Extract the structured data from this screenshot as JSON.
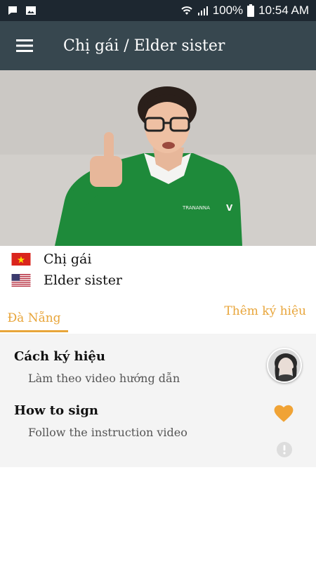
{
  "status_bar": {
    "battery": "100%",
    "time": "10:54 AM",
    "icons": [
      "chat-icon",
      "image-icon",
      "wifi-icon",
      "signal-icon",
      "battery-icon"
    ]
  },
  "app_bar": {
    "title": "Chị gái / Elder sister",
    "menu_icon": "hamburger-icon",
    "background": "#37474f"
  },
  "translations": [
    {
      "flag": "vietnam-flag-icon",
      "text": "Chị gái"
    },
    {
      "flag": "usa-flag-icon",
      "text": "Elder sister"
    }
  ],
  "tabs": {
    "region_label": "Đà Nẵng",
    "add_sign_label": "Thêm ký hiệu",
    "accent": "#e8a53a"
  },
  "instructions": {
    "vi_title": "Cách ký hiệu",
    "vi_text": "Làm theo video hướng dẫn",
    "en_title": "How to sign",
    "en_text": "Follow the instruction video"
  },
  "actions": [
    "heart-icon",
    "report-icon"
  ]
}
